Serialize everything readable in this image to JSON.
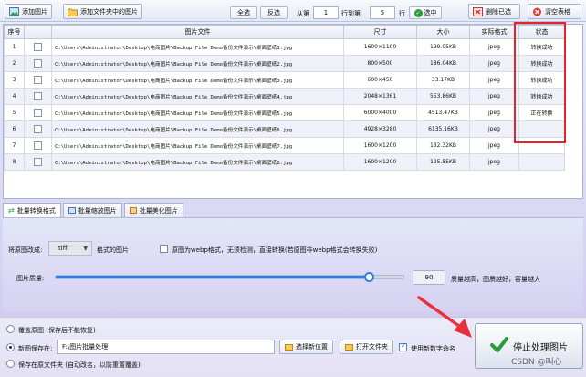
{
  "toolbar": {
    "add_image": "添加图片",
    "add_folder": "添加文件夹中的图片",
    "select_all": "全选",
    "invert": "反选",
    "from_label": "从第",
    "from_value": "1",
    "to_label": "行到第",
    "to_value": "5",
    "row_label": "行",
    "select_label": "选中",
    "delete_selected": "删除已选",
    "clear_table": "清空表格"
  },
  "table": {
    "headers": [
      "序号",
      "",
      "图片文件",
      "尺寸",
      "大小",
      "实际格式",
      "状态"
    ],
    "rows": [
      {
        "no": "1",
        "path": "C:\\Users\\Administrator\\Desktop\\电商图片\\Backup File Demo备份文件演示\\桌面壁纸1.jpg",
        "size": "1600×1100",
        "bytes": "199.05KB",
        "format": "jpeg",
        "status": "转换成功"
      },
      {
        "no": "2",
        "path": "C:\\Users\\Administrator\\Desktop\\电商图片\\Backup File Demo备份文件演示\\桌面壁纸2.jpg",
        "size": "800×500",
        "bytes": "186.04KB",
        "format": "jpeg",
        "status": "转换成功"
      },
      {
        "no": "3",
        "path": "C:\\Users\\Administrator\\Desktop\\电商图片\\Backup File Demo备份文件演示\\桌面壁纸3.jpg",
        "size": "600×450",
        "bytes": "33.17KB",
        "format": "jpeg",
        "status": "转换成功"
      },
      {
        "no": "4",
        "path": "C:\\Users\\Administrator\\Desktop\\电商图片\\Backup File Demo备份文件演示\\桌面壁纸4.jpg",
        "size": "2048×1361",
        "bytes": "553.86KB",
        "format": "jpeg",
        "status": "转换成功"
      },
      {
        "no": "5",
        "path": "C:\\Users\\Administrator\\Desktop\\电商图片\\Backup File Demo备份文件演示\\桌面壁纸5.jpg",
        "size": "6000×4000",
        "bytes": "4513.47KB",
        "format": "jpeg",
        "status": "正在转换"
      },
      {
        "no": "6",
        "path": "C:\\Users\\Administrator\\Desktop\\电商图片\\Backup File Demo备份文件演示\\桌面壁纸6.jpg",
        "size": "4928×3280",
        "bytes": "6135.16KB",
        "format": "jpeg",
        "status": ""
      },
      {
        "no": "7",
        "path": "C:\\Users\\Administrator\\Desktop\\电商图片\\Backup File Demo备份文件演示\\桌面壁纸7.jpg",
        "size": "1600×1200",
        "bytes": "132.32KB",
        "format": "jpeg",
        "status": ""
      },
      {
        "no": "8",
        "path": "C:\\Users\\Administrator\\Desktop\\电商图片\\Backup File Demo备份文件演示\\桌面壁纸8.jpg",
        "size": "1600×1200",
        "bytes": "125.55KB",
        "format": "jpeg",
        "status": ""
      }
    ]
  },
  "tabs": [
    "批量转换格式",
    "批量缩放图片",
    "批量美化图片"
  ],
  "convert": {
    "change_to": "将原图改成:",
    "format_value": "tiff",
    "format_suffix": "格式的图片",
    "webp_option": "原图为webp格式，无须检测，直接转换(若原图非webp格式会转换失败)",
    "quality_label": "图片质量:",
    "quality_value": "90",
    "quality_fraction": 0.9,
    "quality_hint": "质量越高，图质越好，容量越大"
  },
  "output": {
    "overwrite": "覆盖原图 (保存后不能恢复)",
    "save_to": "新图保存在:",
    "path": "F:\\图片批量处理",
    "choose_location": "选择新位置",
    "open_folder": "打开文件夹",
    "use_new_name": "使用新数字命名",
    "save_original_folder": "保存在原文件夹 (自动改名，以防重置覆盖)",
    "stop_button": "停止处理图片"
  },
  "watermark": "CSDN @叫心",
  "colors": {
    "accent": "#2f7fe3",
    "highlight": "#e8212a",
    "arrow": "#e8303c",
    "success": "#2a9d3a"
  }
}
